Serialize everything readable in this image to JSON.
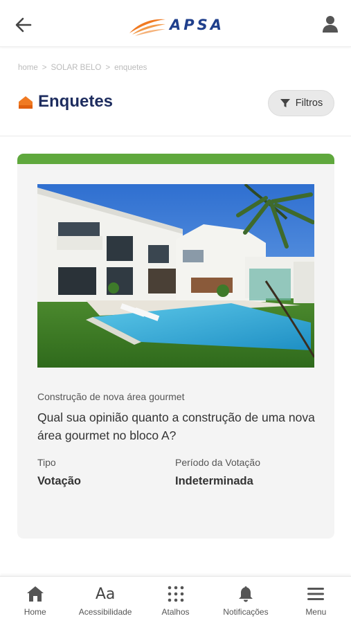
{
  "header": {
    "brand": "APSA",
    "back_icon": "arrow-left-icon",
    "user_icon": "user-icon"
  },
  "breadcrumb": [
    "home",
    ">",
    "SOLAR BELO",
    ">",
    "enquetes"
  ],
  "page": {
    "title": "Enquetes",
    "filter_label": "Filtros",
    "accent": "#f07a22"
  },
  "card": {
    "status_color": "#5fa83d",
    "subtitle": "Construção de nova área gourmet",
    "question": "Qual sua opinião quanto a construção de uma nova área gourmet no bloco A?",
    "type_label": "Tipo",
    "type_value": "Votação",
    "period_label": "Período da Votação",
    "period_value": "Indeterminada"
  },
  "nav": {
    "items": [
      {
        "label": "Home",
        "icon": "home-icon"
      },
      {
        "label": "Acessibilidade",
        "icon": "accessibility-text-icon",
        "glyph": "Aa"
      },
      {
        "label": "Atalhos",
        "icon": "grid-dots-icon"
      },
      {
        "label": "Notificações",
        "icon": "bell-icon"
      },
      {
        "label": "Menu",
        "icon": "hamburger-menu-icon"
      }
    ]
  }
}
